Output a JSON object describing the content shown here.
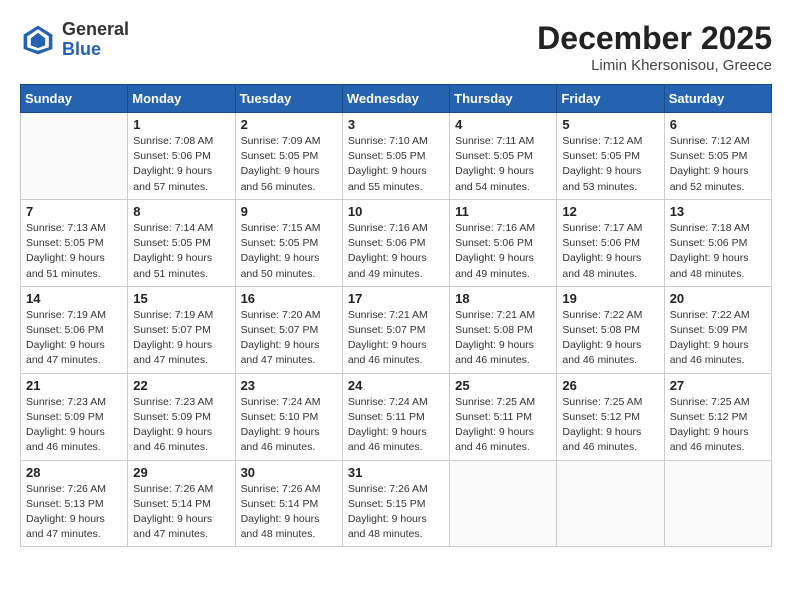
{
  "header": {
    "logo_general": "General",
    "logo_blue": "Blue",
    "month_title": "December 2025",
    "location": "Limin Khersonisou, Greece"
  },
  "days_of_week": [
    "Sunday",
    "Monday",
    "Tuesday",
    "Wednesday",
    "Thursday",
    "Friday",
    "Saturday"
  ],
  "weeks": [
    [
      {
        "day": "",
        "info": ""
      },
      {
        "day": "1",
        "info": "Sunrise: 7:08 AM\nSunset: 5:06 PM\nDaylight: 9 hours\nand 57 minutes."
      },
      {
        "day": "2",
        "info": "Sunrise: 7:09 AM\nSunset: 5:05 PM\nDaylight: 9 hours\nand 56 minutes."
      },
      {
        "day": "3",
        "info": "Sunrise: 7:10 AM\nSunset: 5:05 PM\nDaylight: 9 hours\nand 55 minutes."
      },
      {
        "day": "4",
        "info": "Sunrise: 7:11 AM\nSunset: 5:05 PM\nDaylight: 9 hours\nand 54 minutes."
      },
      {
        "day": "5",
        "info": "Sunrise: 7:12 AM\nSunset: 5:05 PM\nDaylight: 9 hours\nand 53 minutes."
      },
      {
        "day": "6",
        "info": "Sunrise: 7:12 AM\nSunset: 5:05 PM\nDaylight: 9 hours\nand 52 minutes."
      }
    ],
    [
      {
        "day": "7",
        "info": "Sunrise: 7:13 AM\nSunset: 5:05 PM\nDaylight: 9 hours\nand 51 minutes."
      },
      {
        "day": "8",
        "info": "Sunrise: 7:14 AM\nSunset: 5:05 PM\nDaylight: 9 hours\nand 51 minutes."
      },
      {
        "day": "9",
        "info": "Sunrise: 7:15 AM\nSunset: 5:05 PM\nDaylight: 9 hours\nand 50 minutes."
      },
      {
        "day": "10",
        "info": "Sunrise: 7:16 AM\nSunset: 5:06 PM\nDaylight: 9 hours\nand 49 minutes."
      },
      {
        "day": "11",
        "info": "Sunrise: 7:16 AM\nSunset: 5:06 PM\nDaylight: 9 hours\nand 49 minutes."
      },
      {
        "day": "12",
        "info": "Sunrise: 7:17 AM\nSunset: 5:06 PM\nDaylight: 9 hours\nand 48 minutes."
      },
      {
        "day": "13",
        "info": "Sunrise: 7:18 AM\nSunset: 5:06 PM\nDaylight: 9 hours\nand 48 minutes."
      }
    ],
    [
      {
        "day": "14",
        "info": "Sunrise: 7:19 AM\nSunset: 5:06 PM\nDaylight: 9 hours\nand 47 minutes."
      },
      {
        "day": "15",
        "info": "Sunrise: 7:19 AM\nSunset: 5:07 PM\nDaylight: 9 hours\nand 47 minutes."
      },
      {
        "day": "16",
        "info": "Sunrise: 7:20 AM\nSunset: 5:07 PM\nDaylight: 9 hours\nand 47 minutes."
      },
      {
        "day": "17",
        "info": "Sunrise: 7:21 AM\nSunset: 5:07 PM\nDaylight: 9 hours\nand 46 minutes."
      },
      {
        "day": "18",
        "info": "Sunrise: 7:21 AM\nSunset: 5:08 PM\nDaylight: 9 hours\nand 46 minutes."
      },
      {
        "day": "19",
        "info": "Sunrise: 7:22 AM\nSunset: 5:08 PM\nDaylight: 9 hours\nand 46 minutes."
      },
      {
        "day": "20",
        "info": "Sunrise: 7:22 AM\nSunset: 5:09 PM\nDaylight: 9 hours\nand 46 minutes."
      }
    ],
    [
      {
        "day": "21",
        "info": "Sunrise: 7:23 AM\nSunset: 5:09 PM\nDaylight: 9 hours\nand 46 minutes."
      },
      {
        "day": "22",
        "info": "Sunrise: 7:23 AM\nSunset: 5:09 PM\nDaylight: 9 hours\nand 46 minutes."
      },
      {
        "day": "23",
        "info": "Sunrise: 7:24 AM\nSunset: 5:10 PM\nDaylight: 9 hours\nand 46 minutes."
      },
      {
        "day": "24",
        "info": "Sunrise: 7:24 AM\nSunset: 5:11 PM\nDaylight: 9 hours\nand 46 minutes."
      },
      {
        "day": "25",
        "info": "Sunrise: 7:25 AM\nSunset: 5:11 PM\nDaylight: 9 hours\nand 46 minutes."
      },
      {
        "day": "26",
        "info": "Sunrise: 7:25 AM\nSunset: 5:12 PM\nDaylight: 9 hours\nand 46 minutes."
      },
      {
        "day": "27",
        "info": "Sunrise: 7:25 AM\nSunset: 5:12 PM\nDaylight: 9 hours\nand 46 minutes."
      }
    ],
    [
      {
        "day": "28",
        "info": "Sunrise: 7:26 AM\nSunset: 5:13 PM\nDaylight: 9 hours\nand 47 minutes."
      },
      {
        "day": "29",
        "info": "Sunrise: 7:26 AM\nSunset: 5:14 PM\nDaylight: 9 hours\nand 47 minutes."
      },
      {
        "day": "30",
        "info": "Sunrise: 7:26 AM\nSunset: 5:14 PM\nDaylight: 9 hours\nand 48 minutes."
      },
      {
        "day": "31",
        "info": "Sunrise: 7:26 AM\nSunset: 5:15 PM\nDaylight: 9 hours\nand 48 minutes."
      },
      {
        "day": "",
        "info": ""
      },
      {
        "day": "",
        "info": ""
      },
      {
        "day": "",
        "info": ""
      }
    ]
  ]
}
